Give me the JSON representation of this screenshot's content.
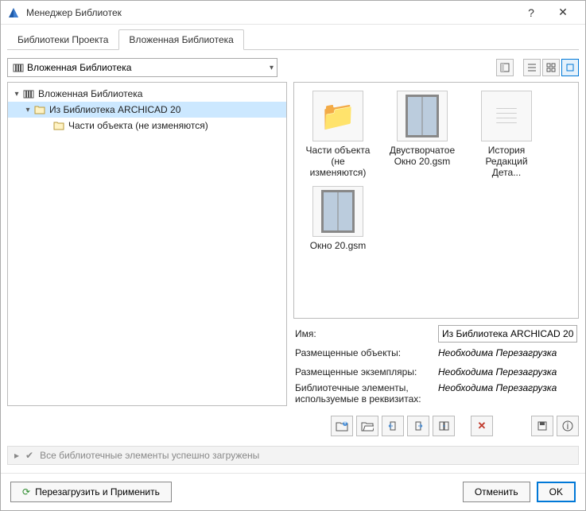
{
  "window": {
    "title": "Менеджер Библиотек"
  },
  "tabs": [
    "Библиотеки Проекта",
    "Вложенная Библиотека"
  ],
  "active_tab": 1,
  "combo": {
    "label": "Вложенная Библиотека"
  },
  "tree": {
    "root": "Вложенная Библиотека",
    "child": "Из Библиотека ARCHICAD 20",
    "grandchild": "Части объекта (не изменяются)"
  },
  "items": [
    {
      "name": "Части объекта (не изменяются)",
      "kind": "folder"
    },
    {
      "name": "Двустворчатое Окно 20.gsm",
      "kind": "window"
    },
    {
      "name": "История Редакций Дета...",
      "kind": "sheet"
    },
    {
      "name": "Окно 20.gsm",
      "kind": "window"
    }
  ],
  "props": {
    "name_label": "Имя:",
    "name_value": "Из Библиотека ARCHICAD 20",
    "placed_objects_label": "Размещенные объекты:",
    "placed_objects_value": "Необходима Перезагрузка",
    "placed_instances_label": "Размещенные экземпляры:",
    "placed_instances_value": "Необходима Перезагрузка",
    "attrib_label_1": "Библиотечные элементы,",
    "attrib_label_2": "используемые в реквизитах:",
    "attrib_value": "Необходима Перезагрузка"
  },
  "status": "Все библиотечные элементы успешно загружены",
  "footer": {
    "reload": "Перезагрузить и Применить",
    "cancel": "Отменить",
    "ok": "OK"
  }
}
